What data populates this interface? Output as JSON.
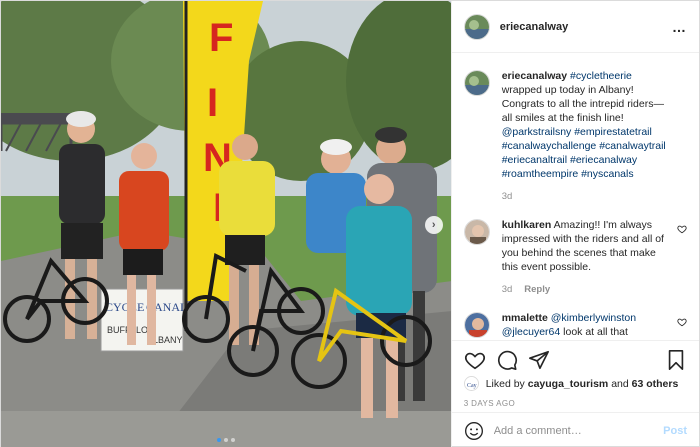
{
  "post": {
    "account": "eriecanalway",
    "photo_sign_text": "FINI",
    "photo_banner_text": [
      "CYCLE",
      "CANAL",
      "BUFFALO",
      "ALBANY"
    ],
    "caption": {
      "user": "eriecanalway",
      "parts": [
        {
          "text": "#cycletheerie",
          "link": true
        },
        {
          "text": " wrapped up today in Albany! Congrats to all the intrepid riders— all smiles at the finish line! ",
          "link": false
        },
        {
          "text": "@parkstrailsny",
          "link": true
        },
        {
          "text": " ",
          "link": false
        },
        {
          "text": "#empirestatetrail",
          "link": true
        },
        {
          "text": " ",
          "link": false
        },
        {
          "text": "#canalwaychallenge",
          "link": true
        },
        {
          "text": " ",
          "link": false
        },
        {
          "text": "#canalwaytrail",
          "link": true
        },
        {
          "text": " ",
          "link": false
        },
        {
          "text": "#eriecanaltrail",
          "link": true
        },
        {
          "text": " ",
          "link": false
        },
        {
          "text": "#eriecanalway",
          "link": true
        },
        {
          "text": " ",
          "link": false
        },
        {
          "text": "#roamtheempire",
          "link": true
        },
        {
          "text": " ",
          "link": false
        },
        {
          "text": "#nyscanals",
          "link": true
        }
      ],
      "age": "3d"
    },
    "comments": [
      {
        "user": "kuhlkaren",
        "text": "Amazing!! I'm always impressed with the riders and all of you behind the scenes that make this event possible.",
        "age": "3d",
        "reply_label": "Reply"
      },
      {
        "user": "mmalette",
        "mention1": "@kimberlywinston",
        "mention2": "@jlecuyer64",
        "tail": " look at all that"
      }
    ],
    "likes": {
      "prefix": "Liked by ",
      "user": "cayuga_tourism",
      "suffix": " and ",
      "count_text": "63 others"
    },
    "timestamp": "3 days ago",
    "add_comment": {
      "placeholder": "Add a comment…",
      "post_label": "Post"
    },
    "carousel": {
      "dots": 3,
      "active_index": 0
    },
    "more_glyph": "…",
    "colors": {
      "link": "#00376b",
      "muted": "#8e8e8e",
      "post_button": "#b3dbff",
      "carousel_active": "#3897f0"
    },
    "icons": [
      "heart-icon",
      "comment-icon",
      "share-icon",
      "bookmark-icon",
      "emoji-icon",
      "chevron-right-icon",
      "more-icon"
    ]
  }
}
